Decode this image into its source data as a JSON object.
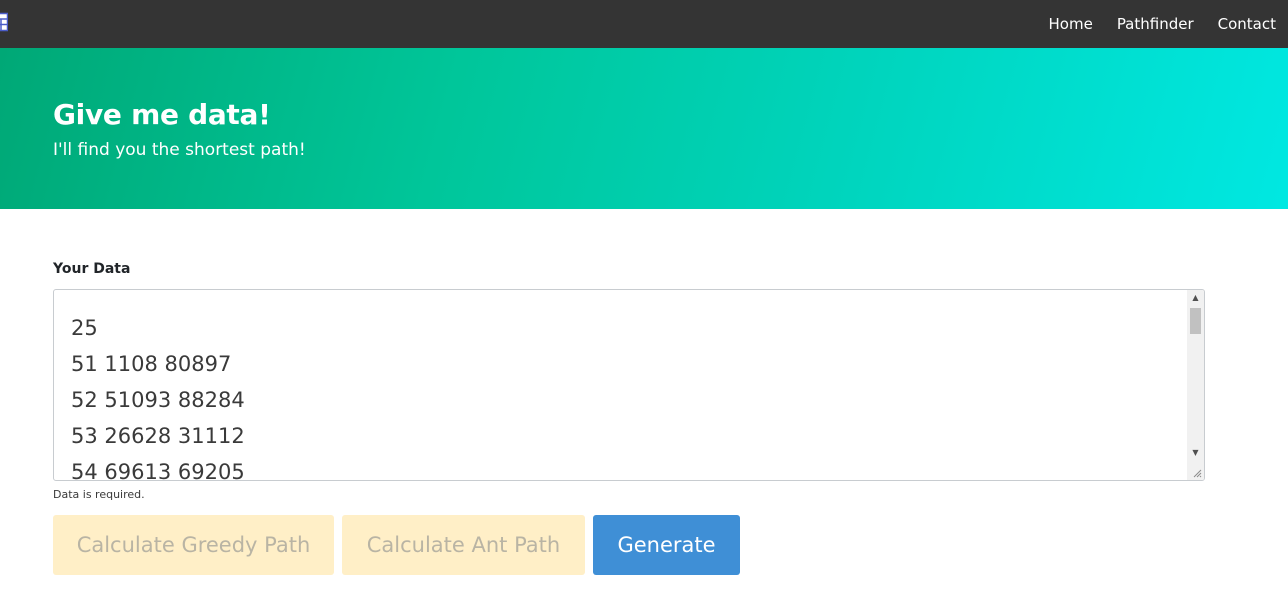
{
  "navbar": {
    "brand_icon": "calendar-icon",
    "links": [
      {
        "label": "Home"
      },
      {
        "label": "Pathfinder"
      },
      {
        "label": "Contact"
      }
    ]
  },
  "hero": {
    "title": "Give me data!",
    "subtitle": "I'll find you the shortest path!"
  },
  "form": {
    "label": "Your Data",
    "value_lines": [
      "25",
      "51 1108 80897",
      "52 51093 88284",
      "53 26628 31112",
      "54 69613 69205"
    ],
    "validation_message": "Data is required."
  },
  "buttons": {
    "greedy_label": "Calculate Greedy Path",
    "ant_label": "Calculate Ant Path",
    "generate_label": "Generate"
  },
  "colors": {
    "navbar": "#343434",
    "hero_start": "#00a876",
    "hero_end": "#00e8e2",
    "disabled_button_bg": "#ffefc7",
    "primary_button_bg": "#3f8fd6"
  }
}
